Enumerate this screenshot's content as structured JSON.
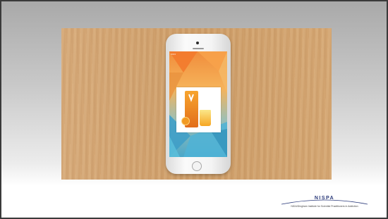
{
  "slide": {
    "background_top": "#a9a9a9",
    "background_bottom": "#ffffff",
    "border_color": "#3a3a3a"
  },
  "video": {
    "background": "wood-table",
    "device": "smartphone",
    "screen_colors": [
      "#f08d3c",
      "#f6b35a",
      "#4aa7c9"
    ],
    "app_tile_icon": "orange-juice-icon"
  },
  "logo": {
    "title": "NISPA",
    "subtitle": "NIDA/Dingham Institute for Scientist Practitioners in Addiction",
    "accent_color": "#2b3a7a"
  }
}
